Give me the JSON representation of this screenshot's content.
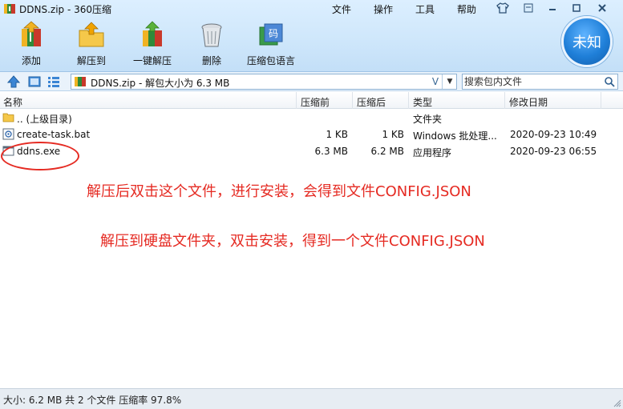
{
  "window": {
    "title": "DDNS.zip - 360压缩"
  },
  "menu": [
    "文件",
    "操作",
    "工具",
    "帮助"
  ],
  "profile": {
    "label": "未知"
  },
  "toolbar": [
    {
      "name": "add-button",
      "label": "添加",
      "icon": "add-archive-icon"
    },
    {
      "name": "extract-to-button",
      "label": "解压到",
      "icon": "extract-folder-icon"
    },
    {
      "name": "one-click-extract-button",
      "label": "一键解压",
      "icon": "one-click-extract-icon"
    },
    {
      "name": "delete-button",
      "label": "删除",
      "icon": "trash-icon"
    },
    {
      "name": "archive-password-button",
      "label": "压缩包语言",
      "icon": "code-book-icon"
    }
  ],
  "address": {
    "path": "DDNS.zip - 解包大小为 6.3 MB",
    "search_placeholder": "搜索包内文件"
  },
  "columns": {
    "name": "名称",
    "compressed": "压缩前",
    "uncompressed": "压缩后",
    "type": "类型",
    "modified": "修改日期"
  },
  "files": [
    {
      "name": ".. (上级目录)",
      "before": "",
      "after": "",
      "type": "文件夹",
      "modified": "",
      "icon": "folder-icon"
    },
    {
      "name": "create-task.bat",
      "before": "1 KB",
      "after": "1 KB",
      "type": "Windows 批处理...",
      "modified": "2020-09-23 10:49",
      "icon": "batch-file-icon"
    },
    {
      "name": "ddns.exe",
      "before": "6.3 MB",
      "after": "6.2 MB",
      "type": "应用程序",
      "modified": "2020-09-23 06:55",
      "icon": "exe-file-icon"
    }
  ],
  "annotations": [
    "解压后双击这个文件，进行安装，会得到文件CONFIG.JSON",
    "解压到硬盘文件夹，双击安装，得到一个文件CONFIG.JSON"
  ],
  "status": "大小: 6.2 MB 共 2 个文件 压缩率 97.8%",
  "colors": {
    "annotation": "#e52a22",
    "toolbar_bg": "#cfe7fb",
    "profile": "#1f7fd8"
  }
}
